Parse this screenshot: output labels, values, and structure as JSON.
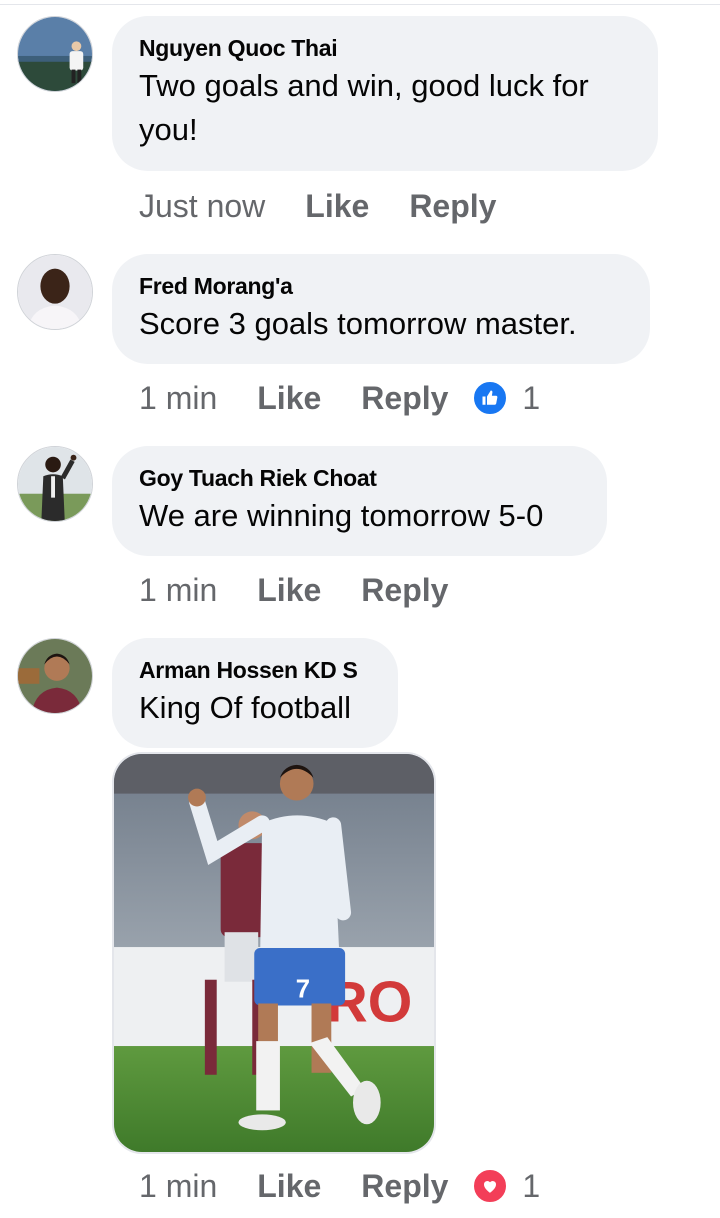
{
  "comments": [
    {
      "author": "Nguyen Quoc Thai",
      "text": "Two goals and win, good luck for you!",
      "time": "Just now",
      "like_label": "Like",
      "reply_label": "Reply"
    },
    {
      "author": "Fred Morang'a",
      "text": "Score 3 goals tomorrow master.",
      "time": "1 min",
      "like_label": "Like",
      "reply_label": "Reply",
      "reaction": {
        "icon": "thumbs-up-icon",
        "count": "1",
        "color": "#1877f2"
      }
    },
    {
      "author": "Goy Tuach Riek Choat",
      "text": "We are winning tomorrow 5-0",
      "time": "1 min",
      "like_label": "Like",
      "reply_label": "Reply"
    },
    {
      "author": "Arman Hossen KD S",
      "text": "King Of football",
      "time": "1 min",
      "like_label": "Like",
      "reply_label": "Reply",
      "reaction": {
        "icon": "heart-icon",
        "count": "1",
        "color": "#f33e58"
      }
    }
  ],
  "colors": {
    "bubble_bg": "#f0f2f5",
    "meta_text": "#65676b",
    "like_blue": "#1877f2",
    "love_red": "#f33e58"
  }
}
